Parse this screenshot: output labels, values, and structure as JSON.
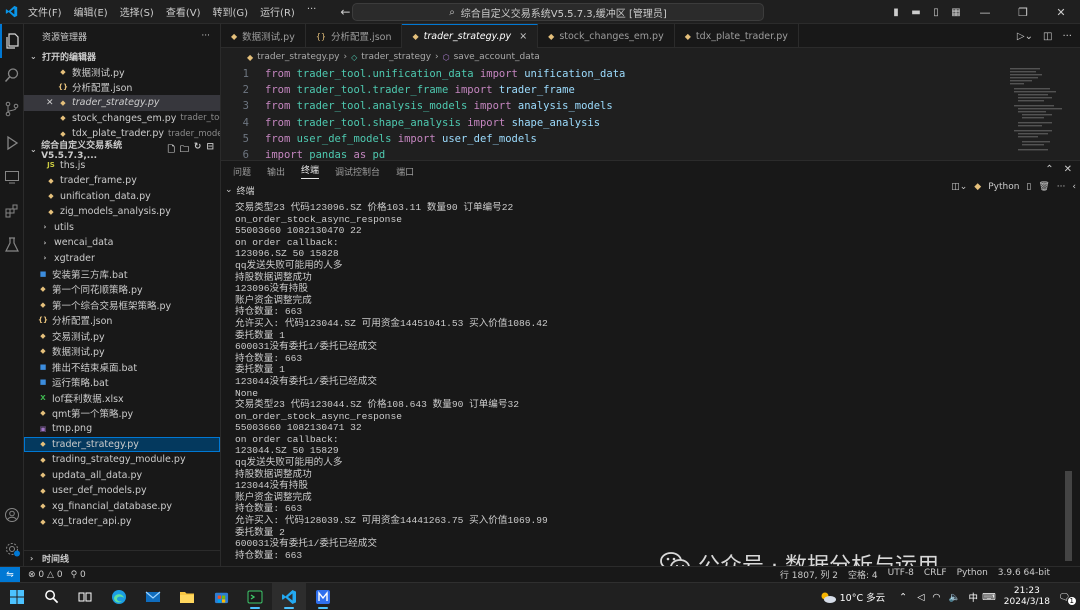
{
  "titlebar": {
    "menu": [
      "文件(F)",
      "编辑(E)",
      "选择(S)",
      "查看(V)",
      "转到(G)",
      "运行(R)"
    ],
    "more": "···",
    "command_center": "综合自定义交易系统V5.5.7.3,缓冲区 [管理员]"
  },
  "sidebar": {
    "title": "资源管理器",
    "more": "···",
    "open_editors_label": "打开的编辑器",
    "open_editors": [
      {
        "name": "数据测试.py",
        "path": "",
        "icon": "python"
      },
      {
        "name": "分析配置.json",
        "path": "",
        "icon": "json"
      },
      {
        "name": "trader_strategy.py",
        "path": "",
        "icon": "python"
      },
      {
        "name": "stock_changes_em.py",
        "path": "trader_tool",
        "icon": "python"
      },
      {
        "name": "tdx_plate_trader.py",
        "path": "trader_models\\...",
        "icon": "python"
      }
    ],
    "project_label": "综合自定义交易系统V5.5.7.3,...",
    "files": [
      {
        "name": "ths.js",
        "icon": "js",
        "indent": 1
      },
      {
        "name": "trader_frame.py",
        "icon": "python",
        "indent": 1
      },
      {
        "name": "unification_data.py",
        "icon": "python",
        "indent": 1
      },
      {
        "name": "zig_models_analysis.py",
        "icon": "python",
        "indent": 1
      },
      {
        "name": "utils",
        "icon": "folder",
        "indent": 0
      },
      {
        "name": "wencai_data",
        "icon": "folder",
        "indent": 0
      },
      {
        "name": "xgtrader",
        "icon": "folder",
        "indent": 0
      },
      {
        "name": "安装第三方库.bat",
        "icon": "bat",
        "indent": 0
      },
      {
        "name": "第一个同花顺策略.py",
        "icon": "python",
        "indent": 0
      },
      {
        "name": "第一个综合交易框架策略.py",
        "icon": "python",
        "indent": 0
      },
      {
        "name": "分析配置.json",
        "icon": "json",
        "indent": 0
      },
      {
        "name": "交易测试.py",
        "icon": "python",
        "indent": 0
      },
      {
        "name": "数据测试.py",
        "icon": "python",
        "indent": 0
      },
      {
        "name": "推出不结束桌面.bat",
        "icon": "bat",
        "indent": 0
      },
      {
        "name": "运行策略.bat",
        "icon": "bat",
        "indent": 0
      },
      {
        "name": "lof套利数据.xlsx",
        "icon": "xlsx",
        "indent": 0
      },
      {
        "name": "qmt第一个策略.py",
        "icon": "python",
        "indent": 0
      },
      {
        "name": "tmp.png",
        "icon": "png",
        "indent": 0
      },
      {
        "name": "trader_strategy.py",
        "icon": "python",
        "indent": 0
      },
      {
        "name": "trading_strategy_module.py",
        "icon": "python",
        "indent": 0
      },
      {
        "name": "updata_all_data.py",
        "icon": "python",
        "indent": 0
      },
      {
        "name": "user_def_models.py",
        "icon": "python",
        "indent": 0
      },
      {
        "name": "xg_financial_database.py",
        "icon": "python",
        "indent": 0
      },
      {
        "name": "xg_trader_api.py",
        "icon": "python",
        "indent": 0
      }
    ],
    "bottom_section": "时间线"
  },
  "editor": {
    "tabs": [
      {
        "name": "数据测试.py",
        "icon": "python"
      },
      {
        "name": "分析配置.json",
        "icon": "json"
      },
      {
        "name": "trader_strategy.py",
        "icon": "python",
        "close": "×"
      },
      {
        "name": "stock_changes_em.py",
        "icon": "python"
      },
      {
        "name": "tdx_plate_trader.py",
        "icon": "python"
      }
    ],
    "breadcrumb": [
      "trader_strategy.py",
      "trader_strategy",
      "save_account_data"
    ],
    "code": [
      {
        "ln": "1",
        "parts": [
          [
            "kw",
            "from "
          ],
          [
            "mod",
            "trader_tool.unification_data"
          ],
          [
            "kw",
            " import "
          ],
          [
            "nm",
            "unification_data"
          ]
        ]
      },
      {
        "ln": "2",
        "parts": [
          [
            "kw",
            "from "
          ],
          [
            "mod",
            "trader_tool.trader_frame"
          ],
          [
            "kw",
            " import "
          ],
          [
            "nm",
            "trader_frame"
          ]
        ]
      },
      {
        "ln": "3",
        "parts": [
          [
            "kw",
            "from "
          ],
          [
            "mod",
            "trader_tool.analysis_models"
          ],
          [
            "kw",
            " import "
          ],
          [
            "nm",
            "analysis_models"
          ]
        ]
      },
      {
        "ln": "4",
        "parts": [
          [
            "kw",
            "from "
          ],
          [
            "mod",
            "trader_tool.shape_analysis"
          ],
          [
            "kw",
            " import "
          ],
          [
            "nm",
            "shape_analysis"
          ]
        ]
      },
      {
        "ln": "5",
        "parts": [
          [
            "kw",
            "from "
          ],
          [
            "mod",
            "user_def_models"
          ],
          [
            "kw",
            " import "
          ],
          [
            "nm",
            "user_def_models"
          ]
        ]
      },
      {
        "ln": "6",
        "parts": [
          [
            "kw",
            "import "
          ],
          [
            "mod",
            "pandas"
          ],
          [
            "kw",
            " as "
          ],
          [
            "mod",
            "pd"
          ]
        ]
      }
    ]
  },
  "panel": {
    "tabs": [
      "问题",
      "输出",
      "终端",
      "调试控制台",
      "端口"
    ],
    "active_tab": "终端",
    "terminal_label": "终端",
    "shell": "Python",
    "lines": [
      "交易类型23 代码123096.SZ 价格103.11 数量90 订单编号22",
      "on_order_stock_async_response",
      "55003660 1082130470 22",
      "on order callback:",
      "123096.SZ 50 15828",
      "qq发送失败可能用的人多",
      "持股数据调整成功",
      "123096没有持股",
      "账户资金调整完成",
      "持仓数量: 663",
      "允许买入: 代码123044.SZ 可用资金14451041.53 买入价值1086.42",
      "委托数量 1",
      "600031没有委托1/委托已经成交",
      "持仓数量: 663",
      "委托数量 1",
      "123044没有委托1/委托已经成交",
      "None",
      "交易类型23 代码123044.SZ 价格108.643 数量90 订单编号32",
      "on_order_stock_async_response",
      "55003660 1082130471 32",
      "on order callback:",
      "123044.SZ 50 15829",
      "qq发送失败可能用的人多",
      "持股数据调整成功",
      "123044没有持股",
      "账户资金调整完成",
      "持仓数量: 663",
      "允许买入: 代码128039.SZ 可用资金14441263.75 买入价值1069.99",
      "委托数量 2",
      "600031没有委托1/委托已经成交",
      "持仓数量: 663"
    ]
  },
  "statusbar": {
    "errors": "0",
    "warnings": "0",
    "ports": "0",
    "position": "行 1807, 列 2",
    "spaces": "空格: 4",
    "encoding": "UTF-8",
    "eol": "CRLF",
    "language": "Python",
    "version": "3.9.6 64-bit"
  },
  "watermark": "公众号 · 数据分析与运用",
  "taskbar": {
    "weather": "10°C 多云",
    "ime": "中",
    "time": "21:23",
    "date": "2024/3/18",
    "notifications": "1"
  },
  "colors": {
    "accent": "#0078d4",
    "keyword": "#c586c0",
    "module": "#4ec9b0",
    "name": "#9cdcfe"
  }
}
